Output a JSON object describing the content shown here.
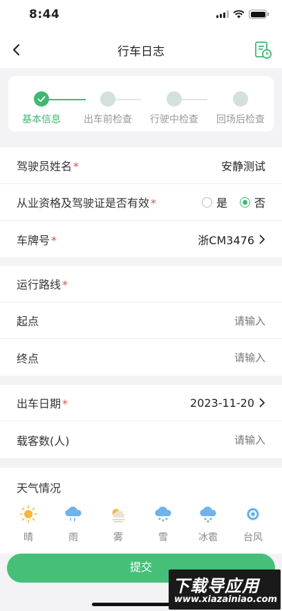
{
  "status_bar": {
    "time": "8:44"
  },
  "nav": {
    "title": "行车日志"
  },
  "steps": [
    {
      "label": "基本信息",
      "state": "done"
    },
    {
      "label": "出车前检查",
      "state": "pending"
    },
    {
      "label": "行驶中检查",
      "state": "pending"
    },
    {
      "label": "回场后检查",
      "state": "pending"
    }
  ],
  "driver": {
    "label": "驾驶员姓名",
    "required": "*",
    "value": "安静测试"
  },
  "qualification": {
    "label": "从业资格及驾驶证是否有效",
    "required": "*",
    "option_yes": "是",
    "option_no": "否",
    "selected": "否"
  },
  "plate": {
    "label": "车牌号",
    "required": "*",
    "value": "浙CM3476"
  },
  "route": {
    "label": "运行路线",
    "required": "*"
  },
  "start": {
    "label": "起点",
    "placeholder": "请输入"
  },
  "end": {
    "label": "终点",
    "placeholder": "请输入"
  },
  "date": {
    "label": "出车日期",
    "required": "*",
    "value": "2023-11-20"
  },
  "passengers": {
    "label": "载客数(人)",
    "placeholder": "请输入"
  },
  "weather": {
    "title": "天气情况",
    "options": [
      {
        "label": "晴",
        "icon": "sun-icon"
      },
      {
        "label": "雨",
        "icon": "rain-icon"
      },
      {
        "label": "雾",
        "icon": "fog-icon"
      },
      {
        "label": "雪",
        "icon": "snow-icon"
      },
      {
        "label": "冰雹",
        "icon": "hail-icon"
      },
      {
        "label": "台风",
        "icon": "typhoon-icon"
      }
    ]
  },
  "submit": {
    "label": "提交"
  },
  "watermark": {
    "line1": "下载导应用",
    "line2": "www.xiazainiao.com"
  },
  "colors": {
    "accent": "#46c079",
    "required": "#e14b4b"
  }
}
